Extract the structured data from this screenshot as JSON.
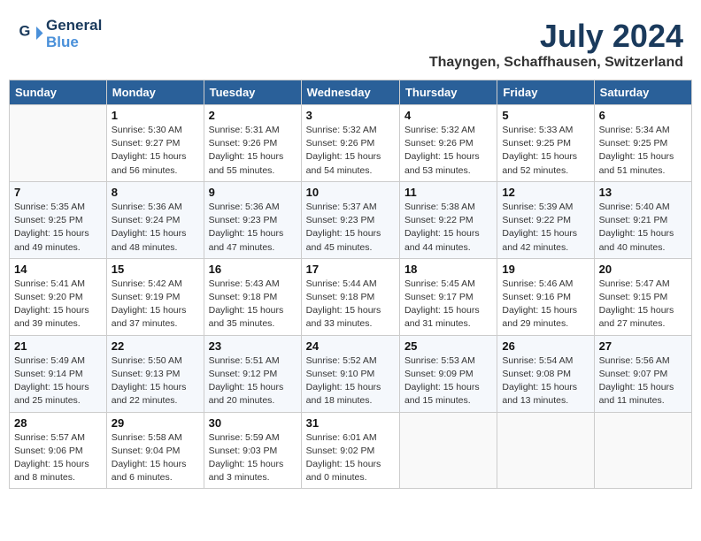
{
  "logo": {
    "line1": "General",
    "line2": "Blue"
  },
  "title": "July 2024",
  "location": "Thayngen, Schaffhausen, Switzerland",
  "days_of_week": [
    "Sunday",
    "Monday",
    "Tuesday",
    "Wednesday",
    "Thursday",
    "Friday",
    "Saturday"
  ],
  "weeks": [
    [
      {
        "day": "",
        "info": ""
      },
      {
        "day": "1",
        "info": "Sunrise: 5:30 AM\nSunset: 9:27 PM\nDaylight: 15 hours\nand 56 minutes."
      },
      {
        "day": "2",
        "info": "Sunrise: 5:31 AM\nSunset: 9:26 PM\nDaylight: 15 hours\nand 55 minutes."
      },
      {
        "day": "3",
        "info": "Sunrise: 5:32 AM\nSunset: 9:26 PM\nDaylight: 15 hours\nand 54 minutes."
      },
      {
        "day": "4",
        "info": "Sunrise: 5:32 AM\nSunset: 9:26 PM\nDaylight: 15 hours\nand 53 minutes."
      },
      {
        "day": "5",
        "info": "Sunrise: 5:33 AM\nSunset: 9:25 PM\nDaylight: 15 hours\nand 52 minutes."
      },
      {
        "day": "6",
        "info": "Sunrise: 5:34 AM\nSunset: 9:25 PM\nDaylight: 15 hours\nand 51 minutes."
      }
    ],
    [
      {
        "day": "7",
        "info": "Sunrise: 5:35 AM\nSunset: 9:25 PM\nDaylight: 15 hours\nand 49 minutes."
      },
      {
        "day": "8",
        "info": "Sunrise: 5:36 AM\nSunset: 9:24 PM\nDaylight: 15 hours\nand 48 minutes."
      },
      {
        "day": "9",
        "info": "Sunrise: 5:36 AM\nSunset: 9:23 PM\nDaylight: 15 hours\nand 47 minutes."
      },
      {
        "day": "10",
        "info": "Sunrise: 5:37 AM\nSunset: 9:23 PM\nDaylight: 15 hours\nand 45 minutes."
      },
      {
        "day": "11",
        "info": "Sunrise: 5:38 AM\nSunset: 9:22 PM\nDaylight: 15 hours\nand 44 minutes."
      },
      {
        "day": "12",
        "info": "Sunrise: 5:39 AM\nSunset: 9:22 PM\nDaylight: 15 hours\nand 42 minutes."
      },
      {
        "day": "13",
        "info": "Sunrise: 5:40 AM\nSunset: 9:21 PM\nDaylight: 15 hours\nand 40 minutes."
      }
    ],
    [
      {
        "day": "14",
        "info": "Sunrise: 5:41 AM\nSunset: 9:20 PM\nDaylight: 15 hours\nand 39 minutes."
      },
      {
        "day": "15",
        "info": "Sunrise: 5:42 AM\nSunset: 9:19 PM\nDaylight: 15 hours\nand 37 minutes."
      },
      {
        "day": "16",
        "info": "Sunrise: 5:43 AM\nSunset: 9:18 PM\nDaylight: 15 hours\nand 35 minutes."
      },
      {
        "day": "17",
        "info": "Sunrise: 5:44 AM\nSunset: 9:18 PM\nDaylight: 15 hours\nand 33 minutes."
      },
      {
        "day": "18",
        "info": "Sunrise: 5:45 AM\nSunset: 9:17 PM\nDaylight: 15 hours\nand 31 minutes."
      },
      {
        "day": "19",
        "info": "Sunrise: 5:46 AM\nSunset: 9:16 PM\nDaylight: 15 hours\nand 29 minutes."
      },
      {
        "day": "20",
        "info": "Sunrise: 5:47 AM\nSunset: 9:15 PM\nDaylight: 15 hours\nand 27 minutes."
      }
    ],
    [
      {
        "day": "21",
        "info": "Sunrise: 5:49 AM\nSunset: 9:14 PM\nDaylight: 15 hours\nand 25 minutes."
      },
      {
        "day": "22",
        "info": "Sunrise: 5:50 AM\nSunset: 9:13 PM\nDaylight: 15 hours\nand 22 minutes."
      },
      {
        "day": "23",
        "info": "Sunrise: 5:51 AM\nSunset: 9:12 PM\nDaylight: 15 hours\nand 20 minutes."
      },
      {
        "day": "24",
        "info": "Sunrise: 5:52 AM\nSunset: 9:10 PM\nDaylight: 15 hours\nand 18 minutes."
      },
      {
        "day": "25",
        "info": "Sunrise: 5:53 AM\nSunset: 9:09 PM\nDaylight: 15 hours\nand 15 minutes."
      },
      {
        "day": "26",
        "info": "Sunrise: 5:54 AM\nSunset: 9:08 PM\nDaylight: 15 hours\nand 13 minutes."
      },
      {
        "day": "27",
        "info": "Sunrise: 5:56 AM\nSunset: 9:07 PM\nDaylight: 15 hours\nand 11 minutes."
      }
    ],
    [
      {
        "day": "28",
        "info": "Sunrise: 5:57 AM\nSunset: 9:06 PM\nDaylight: 15 hours\nand 8 minutes."
      },
      {
        "day": "29",
        "info": "Sunrise: 5:58 AM\nSunset: 9:04 PM\nDaylight: 15 hours\nand 6 minutes."
      },
      {
        "day": "30",
        "info": "Sunrise: 5:59 AM\nSunset: 9:03 PM\nDaylight: 15 hours\nand 3 minutes."
      },
      {
        "day": "31",
        "info": "Sunrise: 6:01 AM\nSunset: 9:02 PM\nDaylight: 15 hours\nand 0 minutes."
      },
      {
        "day": "",
        "info": ""
      },
      {
        "day": "",
        "info": ""
      },
      {
        "day": "",
        "info": ""
      }
    ]
  ]
}
